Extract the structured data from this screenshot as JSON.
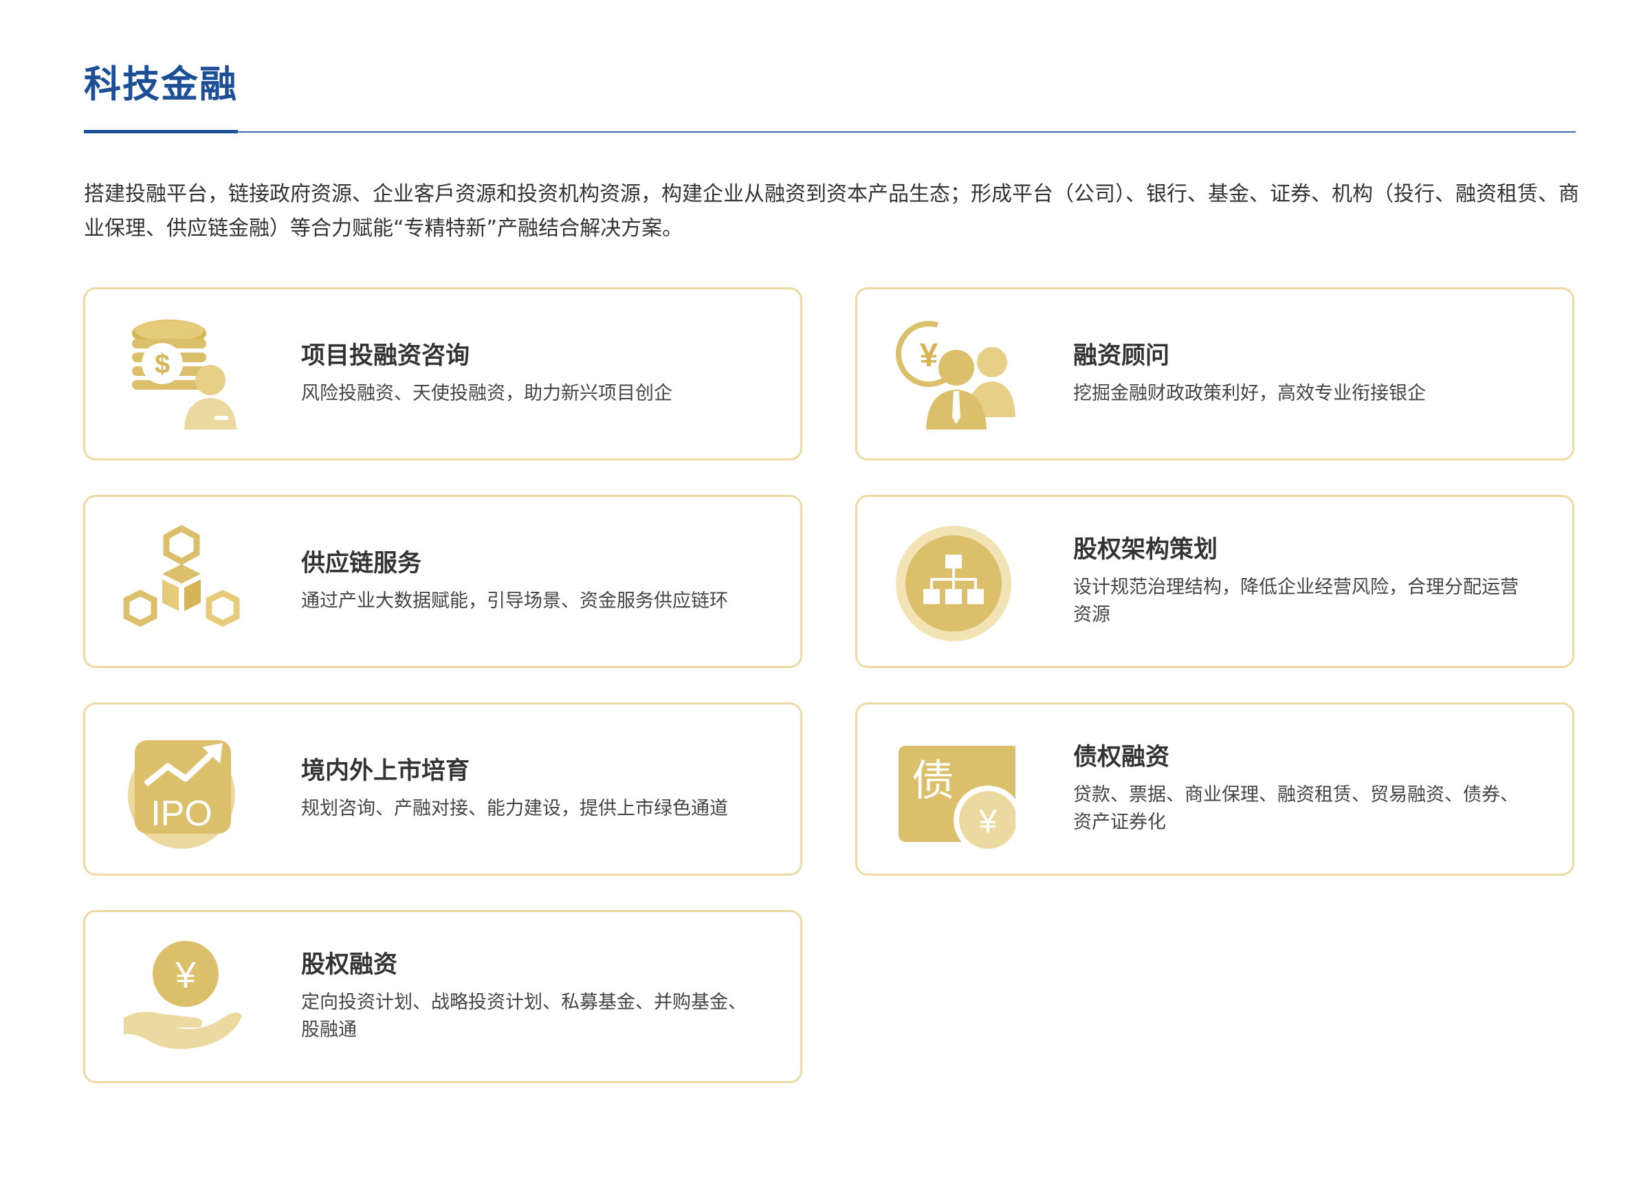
{
  "title": "科技金融",
  "intro": "搭建投融平台，链接政府资源、企业客戶资源和投资机构资源，构建企业从融资到资本产品生态；形成平台（公司）、银行、基金、证券、机构（投行、融资租赁、商业保理、供应链金融）等合力赋能“专精特新”产融结合解决方案。",
  "colors": {
    "title": "#1c4f96",
    "gold": "#dfc373",
    "gold_light": "#efd9a3",
    "card_border": "#efd9a3"
  },
  "cards": [
    {
      "title": "项目投融资咨询",
      "desc": "风险投融资、天使投融资，助力新兴项目创企",
      "icon": "coin-stack-advisor-icon"
    },
    {
      "title": "融资顾问",
      "desc": "挖掘金融财政政策利好，高效专业衔接银企",
      "icon": "yuan-consultants-icon"
    },
    {
      "title": "供应链服务",
      "desc": "通过产业大数据赋能，引导场景、资金服务供应链环",
      "icon": "hexagon-chain-icon"
    },
    {
      "title": "股权架构策划",
      "desc": "设计规范治理结构，降低企业经营风险，合理分配运营资源",
      "icon": "org-chart-icon"
    },
    {
      "title": "境内外上市培育",
      "desc": "规划咨询、产融对接、能力建设，提供上市绿色通道",
      "icon": "ipo-growth-icon",
      "icon_text": "IPO"
    },
    {
      "title": "债权融资",
      "desc": "贷款、票据、商业保理、融资租赁、贸易融资、债券、资产证券化",
      "icon": "debt-yuan-icon",
      "icon_text": "债",
      "icon_symbol": "¥"
    },
    {
      "title": "股权融资",
      "desc": "定向投资计划、战略投资计划、私募基金、并购基金、股融通",
      "icon": "hand-yuan-coin-icon",
      "icon_symbol": "¥"
    }
  ]
}
